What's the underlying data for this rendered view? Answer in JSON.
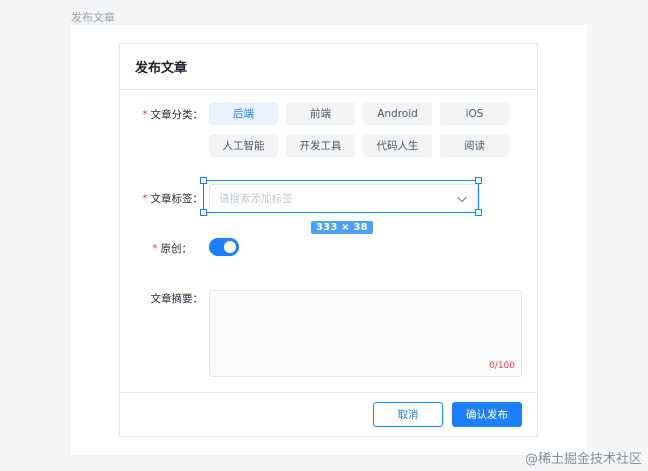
{
  "frame_label": "发布文章",
  "modal": {
    "title": "发布文章"
  },
  "form": {
    "required_mark": "*",
    "category": {
      "label": "文章分类：",
      "options": [
        "后端",
        "前端",
        "Android",
        "iOS",
        "人工智能",
        "开发工具",
        "代码人生",
        "阅读"
      ],
      "selected": "后端"
    },
    "tags": {
      "label": "文章标签：",
      "placeholder": "请搜索添加标签",
      "selection_dimensions": "333 × 38"
    },
    "original": {
      "label": "原创：",
      "enabled": true
    },
    "summary": {
      "label": "文章摘要：",
      "value": "",
      "counter": "0/100"
    }
  },
  "footer": {
    "cancel_label": "取消",
    "confirm_label": "确认发布"
  },
  "watermark": "@稀土掘金技术社区",
  "colors": {
    "primary": "#1e80ff",
    "required": "#f53f3f",
    "selection_badge": "#4ea1f6"
  },
  "icons": {
    "tag_select": "chevron-down-icon"
  }
}
